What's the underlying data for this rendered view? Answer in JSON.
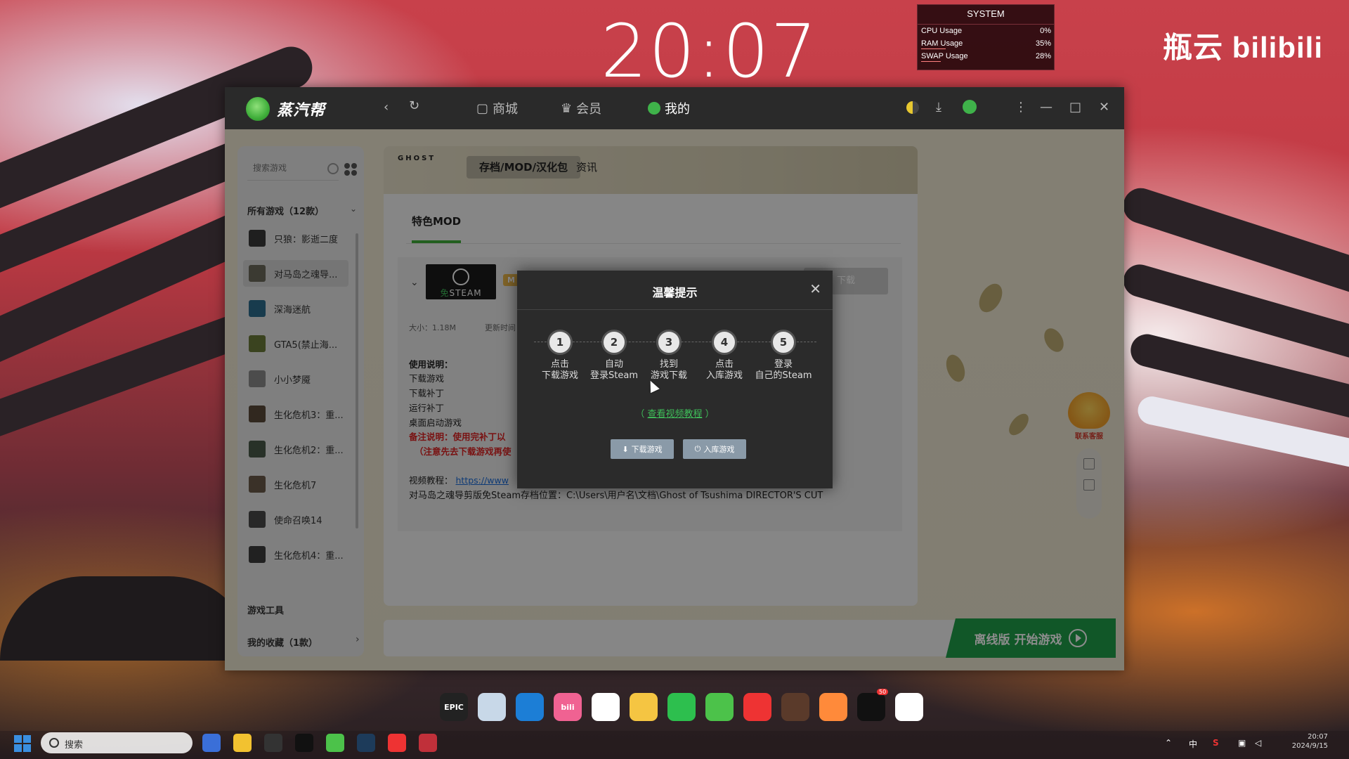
{
  "desktop": {
    "clock": "20:07",
    "system_widget": {
      "title": "SYSTEM",
      "rows": [
        {
          "label": "CPU Usage",
          "value": "0%",
          "level": 0
        },
        {
          "label": "RAM Usage",
          "value": "35%",
          "level": 0.35
        },
        {
          "label": "SWAP Usage",
          "value": "28%",
          "level": 0.28
        }
      ]
    },
    "watermark": "瓶云 bilibili"
  },
  "app": {
    "name": "蒸汽帮",
    "nav": {
      "store": "商城",
      "member": "会员",
      "mine": "我的"
    },
    "sidebar": {
      "search_placeholder": "搜索游戏",
      "all_games": "所有游戏（12款）",
      "games": [
        {
          "label": "只狼：影逝二度",
          "color": "#3a3a3a"
        },
        {
          "label": "对马岛之魂导...",
          "color": "#6c6a5c"
        },
        {
          "label": "深海迷航",
          "color": "#2d6c8c"
        },
        {
          "label": "GTA5(禁止海...",
          "color": "#6b7a3a"
        },
        {
          "label": "小小梦魇",
          "color": "#8a8a8a"
        },
        {
          "label": "生化危机3：重...",
          "color": "#5a4a3a"
        },
        {
          "label": "生化危机2：重...",
          "color": "#4a5a4a"
        },
        {
          "label": "生化危机7",
          "color": "#6a5a4a"
        },
        {
          "label": "使命召唤14",
          "color": "#4a4a4a"
        },
        {
          "label": "生化危机4：重...",
          "color": "#3c3c3c"
        }
      ],
      "tools": "游戏工具",
      "favorites": "我的收藏（1款）"
    },
    "banner": {
      "logo_text": "GHOST",
      "tab_active": "存档/MOD/汉化包",
      "tab_2": "资讯"
    },
    "feature_tab": "特色MOD",
    "mod": {
      "steam_label": "STEAM",
      "steam_free": "免",
      "badge": "M",
      "download": "下载",
      "size": "大小：1.18M",
      "update_time": "更新时间",
      "instructions_title": "使用说明：",
      "instructions": [
        "下载游戏",
        "下载补丁",
        "运行补丁",
        "桌面启动游戏"
      ],
      "note": "备注说明：使用完补丁以",
      "note2": "（注意先去下载游戏再使",
      "video_label": "视频教程：",
      "video_url": "https://www",
      "save_path": "对马岛之魂导剪版免Steam存档位置：C:\\Users\\用户名\\文档\\Ghost of Tsushima DIRECTOR'S CUT"
    },
    "play_button": {
      "label": "离线版  开始游戏"
    },
    "support_label": "联系客服"
  },
  "dialog": {
    "title": "温馨提示",
    "steps": [
      {
        "num": "1",
        "line1": "点击",
        "line2": "下载游戏"
      },
      {
        "num": "2",
        "line1": "自动",
        "line2": "登录Steam"
      },
      {
        "num": "3",
        "line1": "找到",
        "line2": "游戏下载"
      },
      {
        "num": "4",
        "line1": "点击",
        "line2": "入库游戏"
      },
      {
        "num": "5",
        "line1": "登录",
        "line2": "自己的Steam"
      }
    ],
    "video_link": "查看视频教程",
    "btn_download": "下载游戏",
    "btn_import": "入库游戏"
  },
  "taskbar": {
    "search_placeholder": "搜索",
    "tray_ime": "中",
    "time": "20:07",
    "date": "2024/9/15"
  },
  "dock": {
    "icons": [
      {
        "name": "epic-games-icon",
        "label": "EPIC",
        "color": "#222222"
      },
      {
        "name": "recycle-bin-icon",
        "label": "",
        "color": "#c8d8e8"
      },
      {
        "name": "edge-icon",
        "label": "",
        "color": "#1c7ed6"
      },
      {
        "name": "bilibili-icon",
        "label": "bili",
        "color": "#f06292"
      },
      {
        "name": "qq-icon",
        "label": "",
        "color": "#ffffff"
      },
      {
        "name": "folder-icon",
        "label": "",
        "color": "#f5c542"
      },
      {
        "name": "wechat-icon",
        "label": "",
        "color": "#2dbf4e"
      },
      {
        "name": "steam-helper-icon",
        "label": "",
        "color": "#4cc24a"
      },
      {
        "name": "netease-music-icon",
        "label": "",
        "color": "#e33"
      },
      {
        "name": "game-launcher-icon",
        "label": "",
        "color": "#5a3a2a"
      },
      {
        "name": "arc-app-icon",
        "label": "",
        "color": "#ff8a3a"
      },
      {
        "name": "tiktok-icon",
        "label": "",
        "color": "#111111",
        "badge": "50"
      },
      {
        "name": "baidu-netdisk-icon",
        "label": "",
        "color": "#ffffff"
      }
    ]
  }
}
